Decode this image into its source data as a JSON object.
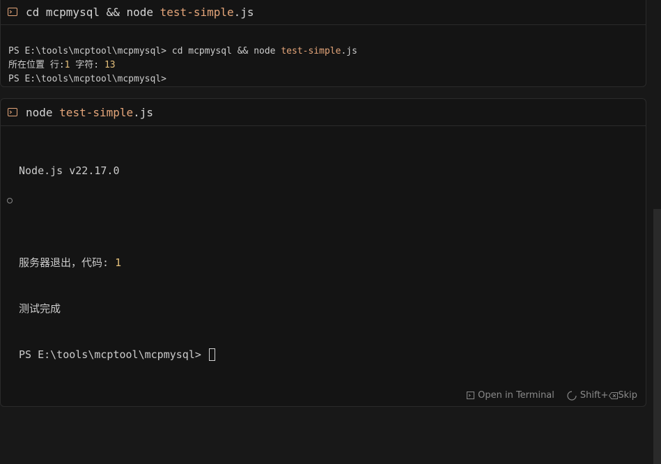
{
  "panel1": {
    "header": {
      "prefix": "cd mcpmysql && node ",
      "highlight": "test-simple",
      "suffix": ".js"
    },
    "lines": {
      "l1_prompt": "PS E:\\tools\\mcptool\\mcpmysql> cd mcpmysql && node ",
      "l1_hl": "test-simple",
      "l1_suffix": ".js",
      "l2_a": "所在位置 行:",
      "l2_row": "1",
      "l2_b": " 字符: ",
      "l2_char": "13",
      "l3": "PS E:\\tools\\mcptool\\mcpmysql>"
    }
  },
  "panel2": {
    "header": {
      "prefix": "node ",
      "highlight": "test-simple",
      "suffix": ".js"
    },
    "lines": {
      "version": "Node.js v22.17.0",
      "exit_text": "服务器退出，代码: ",
      "exit_code": "1",
      "done": "测试完成",
      "prompt": "PS E:\\tools\\mcptool\\mcpmysql> "
    },
    "footer": {
      "open_terminal": "Open in Terminal",
      "skip_shortcut": "Shift+",
      "skip_label": " Skip"
    }
  },
  "colors": {
    "background": "#181818",
    "panel": "#141414",
    "highlight": "#e5a67a",
    "number": "#e5c07b",
    "text": "#cccccc"
  },
  "icons": [
    "terminal-icon",
    "open-terminal-icon",
    "loading-icon",
    "backspace-icon"
  ]
}
